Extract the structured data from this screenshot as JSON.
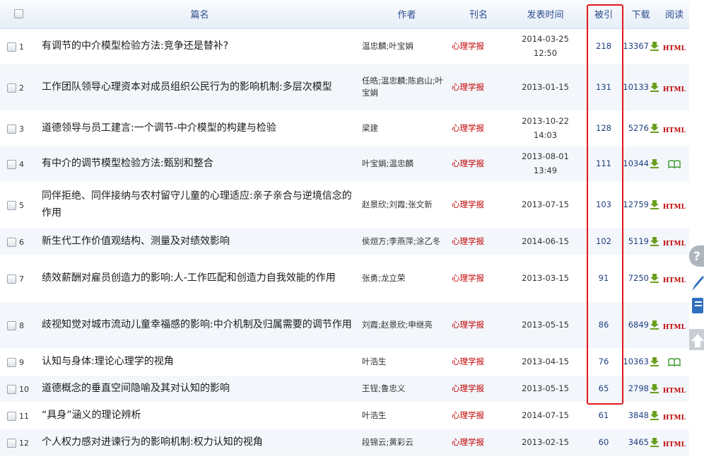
{
  "header": {
    "title_col": "篇名",
    "author_col": "作者",
    "journal_col": "刊名",
    "date_col": "发表时间",
    "cite_col": "被引",
    "download_col": "下载",
    "read_col": "阅读"
  },
  "rows": [
    {
      "num": "1",
      "title": "有调节的中介模型检验方法:竞争还是替补?",
      "authors": "温忠麟;叶宝娟",
      "journal": "心理学报",
      "date": "2014-03-25 12:50",
      "cites": "218",
      "downloads": "13367",
      "read": "HTML"
    },
    {
      "num": "2",
      "title": "工作团队领导心理资本对成员组织公民行为的影响机制:多层次模型",
      "authors": "任皓;温忠麟;陈启山;叶宝娟",
      "journal": "心理学报",
      "date": "2013-01-15",
      "cites": "131",
      "downloads": "10133",
      "read": "HTML"
    },
    {
      "num": "3",
      "title": "道德领导与员工建言:一个调节-中介模型的构建与检验",
      "authors": "梁建",
      "journal": "心理学报",
      "date": "2013-10-22 14:03",
      "cites": "128",
      "downloads": "5276",
      "read": "HTML"
    },
    {
      "num": "4",
      "title": "有中介的调节模型检验方法:甄别和整合",
      "authors": "叶宝娟;温忠麟",
      "journal": "心理学报",
      "date": "2013-08-01 13:49",
      "cites": "111",
      "downloads": "10344",
      "read": "book"
    },
    {
      "num": "5",
      "title": "同伴拒绝、同伴接纳与农村留守儿童的心理适应:亲子亲合与逆境信念的作用",
      "authors": "赵景欣;刘霞;张文新",
      "journal": "心理学报",
      "date": "2013-07-15",
      "cites": "103",
      "downloads": "12759",
      "read": "HTML"
    },
    {
      "num": "6",
      "title": "新生代工作价值观结构、测量及对绩效影响",
      "authors": "侯烜方;李燕萍;涂乙冬",
      "journal": "心理学报",
      "date": "2014-06-15",
      "cites": "102",
      "downloads": "5119",
      "read": "HTML"
    },
    {
      "num": "7",
      "title": "绩效薪酬对雇员创造力的影响:人-工作匹配和创造力自我效能的作用",
      "authors": "张勇;龙立荣",
      "journal": "心理学报",
      "date": "2013-03-15",
      "cites": "91",
      "downloads": "7250",
      "read": "HTML"
    },
    {
      "num": "8",
      "title": "歧视知觉对城市流动儿童幸福感的影响:中介机制及归属需要的调节作用",
      "authors": "刘霞;赵景欣;申继亮",
      "journal": "心理学报",
      "date": "2013-05-15",
      "cites": "86",
      "downloads": "6849",
      "read": "HTML"
    },
    {
      "num": "9",
      "title": "认知与身体:理论心理学的视角",
      "authors": "叶浩生",
      "journal": "心理学报",
      "date": "2013-04-15",
      "cites": "76",
      "downloads": "10363",
      "read": "book"
    },
    {
      "num": "10",
      "title": "道德概念的垂直空间隐喻及其对认知的影响",
      "authors": "王锃;鲁忠义",
      "journal": "心理学报",
      "date": "2013-05-15",
      "cites": "65",
      "downloads": "2798",
      "read": "HTML"
    },
    {
      "num": "11",
      "title": "“具身”涵义的理论辨析",
      "authors": "叶浩生",
      "journal": "心理学报",
      "date": "2014-07-15",
      "cites": "61",
      "downloads": "3848",
      "read": "HTML"
    },
    {
      "num": "12",
      "title": "个人权力感对进谏行为的影响机制:权力认知的视角",
      "authors": "段锦云;黄彩云",
      "journal": "心理学报",
      "date": "2013-02-15",
      "cites": "60",
      "downloads": "3465",
      "read": "HTML"
    }
  ],
  "colors": {
    "highlight_box": "#e0181b",
    "journal": "#c00000",
    "cite": "#1f3f80",
    "download_arrow": "#6a9e1f"
  },
  "icons": {
    "download": "download-arrow-icon",
    "read_html": "html-icon",
    "read_book": "book-icon"
  }
}
